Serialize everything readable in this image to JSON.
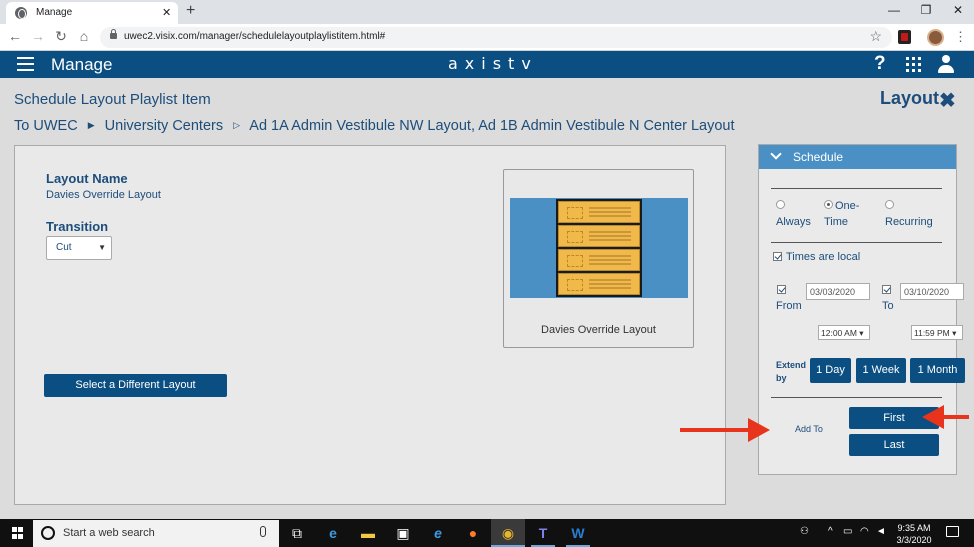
{
  "browser": {
    "tab_title": "Manage",
    "url": "uwec2.visix.com/manager/schedulelayoutplaylistitem.html#",
    "new_tab": "+",
    "tab_close": "✕"
  },
  "header": {
    "app_title": "Manage",
    "logo": "axistv",
    "help": "?"
  },
  "page": {
    "title": "Schedule Layout Playlist Item",
    "layout_link": "Layout",
    "breadcrumb": {
      "prefix": "To",
      "items": [
        "UWEC",
        "University Centers",
        "Ad 1A Admin Vestibule NW Layout, Ad 1B Admin Vestibule N Center Layout"
      ]
    }
  },
  "layout_panel": {
    "layout_name_label": "Layout Name",
    "layout_name_value": "Davies Override Layout",
    "transition_label": "Transition",
    "transition_value": "Cut",
    "select_button": "Select a Different Layout",
    "preview_caption": "Davies Override Layout"
  },
  "schedule": {
    "title": "Schedule",
    "options": [
      {
        "label": "Always",
        "selected": false
      },
      {
        "label": "One-Time",
        "selected": true
      },
      {
        "label": "Recurring",
        "selected": false
      }
    ],
    "option_lines": {
      "always": "Always",
      "onetime_1": "One-",
      "onetime_2": "Time",
      "recurring": "Recurring"
    },
    "times_local_label": "Times are local",
    "from_label": "From",
    "to_label": "To",
    "from_date": "03/03/2020",
    "to_date": "03/10/2020",
    "from_time": "12:00 AM",
    "to_time": "11:59 PM",
    "extend_label_1": "Extend",
    "extend_label_2": "by",
    "extend_buttons": [
      "1 Day",
      "1 Week",
      "1 Month"
    ],
    "add_to_label": "Add To",
    "first_button": "First",
    "last_button": "Last"
  },
  "taskbar": {
    "search_placeholder": "Start a web search",
    "time": "9:35 AM",
    "date": "3/3/2020"
  },
  "colors": {
    "brand_blue": "#0b4e82",
    "panel_header_blue": "#4a90c4",
    "arrow_red": "#e8341c"
  }
}
